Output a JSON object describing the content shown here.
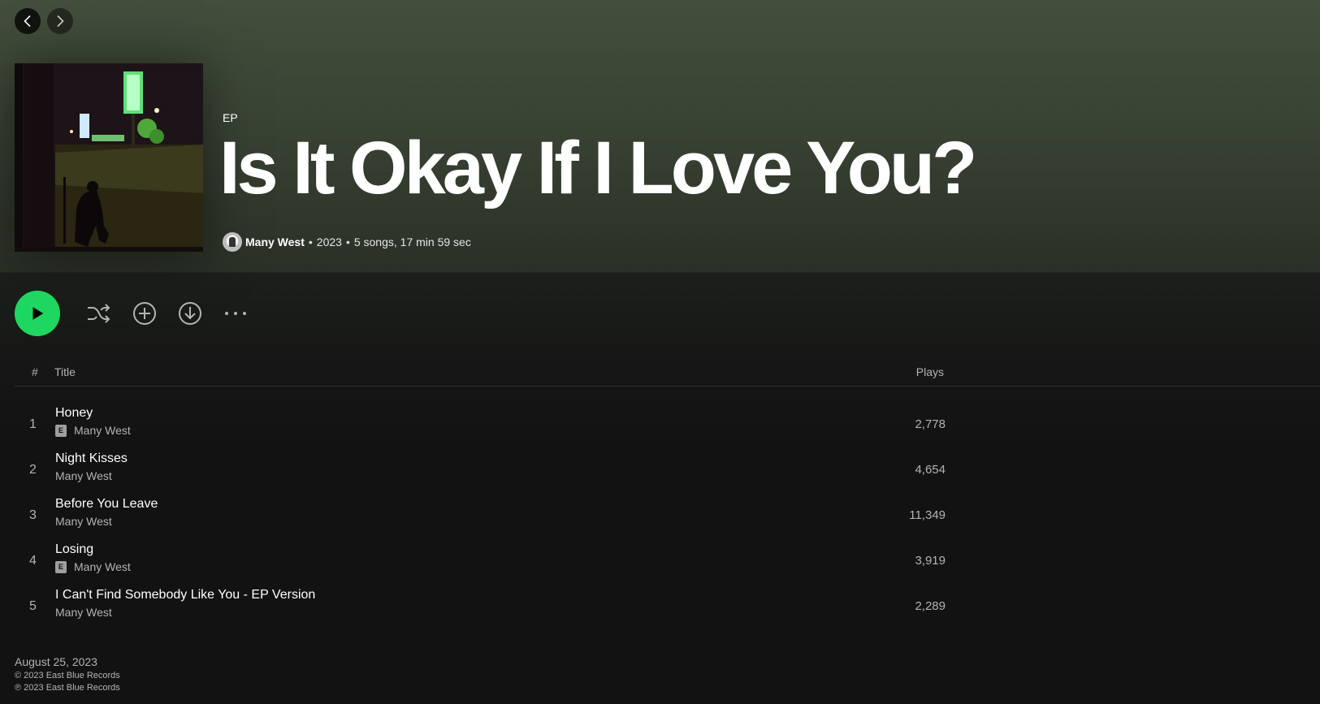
{
  "nav": {
    "back_icon": "chevron-left-icon",
    "forward_icon": "chevron-right-icon"
  },
  "album": {
    "type": "EP",
    "title": "Is It Okay If I Love You?",
    "artist": "Many West",
    "year": "2023",
    "summary": "5 songs, 17 min 59 sec",
    "cover_icon": "album-cover-night-street"
  },
  "actions": {
    "play_icon": "play-icon",
    "shuffle_icon": "shuffle-icon",
    "add_icon": "add-circle-icon",
    "download_icon": "download-icon",
    "more_icon": "more-horizontal-icon",
    "accent_color": "#1ed760"
  },
  "tracklist": {
    "header": {
      "num": "#",
      "title": "Title",
      "plays": "Plays"
    },
    "tracks": [
      {
        "num": "1",
        "name": "Honey",
        "artist": "Many West",
        "explicit": true,
        "plays": "2,778"
      },
      {
        "num": "2",
        "name": "Night Kisses",
        "artist": "Many West",
        "explicit": false,
        "plays": "4,654"
      },
      {
        "num": "3",
        "name": "Before You Leave",
        "artist": "Many West",
        "explicit": false,
        "plays": "11,349"
      },
      {
        "num": "4",
        "name": "Losing",
        "artist": "Many West",
        "explicit": true,
        "plays": "3,919"
      },
      {
        "num": "5",
        "name": "I Can't Find Somebody Like You - EP Version",
        "artist": "Many West",
        "explicit": false,
        "plays": "2,289"
      }
    ],
    "explicit_label": "E"
  },
  "footer": {
    "release_date": "August 25, 2023",
    "copyright": "© 2023 East Blue Records",
    "phonogram": "℗ 2023 East Blue Records"
  }
}
